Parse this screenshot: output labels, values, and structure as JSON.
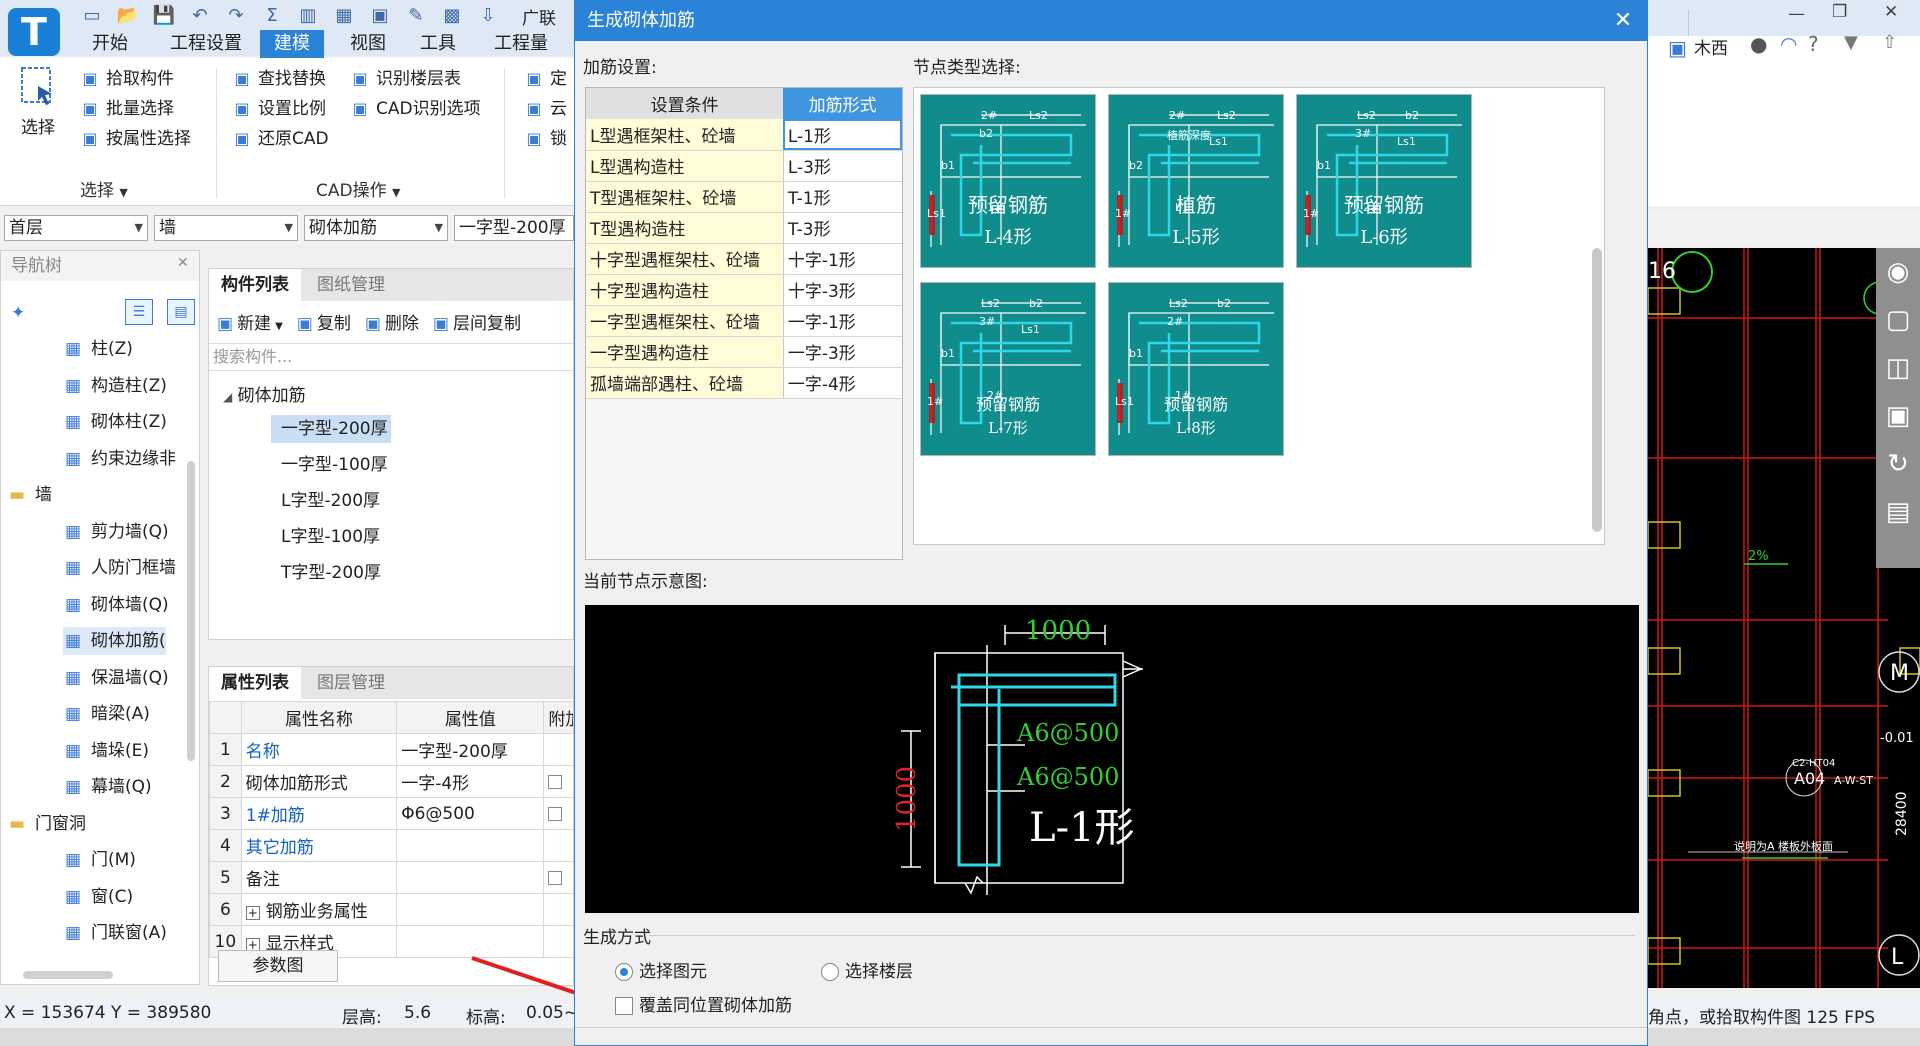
{
  "app": {
    "logo": "T",
    "title_partial": "广联"
  },
  "quick_access": [
    "new-icon",
    "open-icon",
    "save-icon",
    "undo-icon",
    "redo-icon",
    "sum-icon",
    "report-icon",
    "preview-icon",
    "export-icon",
    "pen-icon",
    "grid-icon",
    "import-icon"
  ],
  "menu_tabs": [
    {
      "label": "开始"
    },
    {
      "label": "工程设置"
    },
    {
      "label": "建模"
    },
    {
      "label": "视图"
    },
    {
      "label": "工具"
    },
    {
      "label": "工程量"
    }
  ],
  "ribbon": {
    "select_big": "选择",
    "col1": [
      "拾取构件",
      "批量选择",
      "按属性选择"
    ],
    "col1_group": "选择",
    "col2": [
      "查找替换",
      "设置比例",
      "还原CAD"
    ],
    "col3": [
      "识别楼层表",
      "CAD识别选项"
    ],
    "col2_group": "CAD操作",
    "col4": [
      "定",
      "云",
      "锁"
    ]
  },
  "selectors": [
    "首层",
    "墙",
    "砌体加筋",
    "一字型-200厚"
  ],
  "nav": {
    "title": "导航树",
    "items": [
      {
        "label": "柱(Z)",
        "indent": 1,
        "icon": "column-icon"
      },
      {
        "label": "构造柱(Z)",
        "indent": 1,
        "icon": "construct-column-icon"
      },
      {
        "label": "砌体柱(Z)",
        "indent": 1,
        "icon": "masonry-column-icon"
      },
      {
        "label": "约束边缘非",
        "indent": 1,
        "icon": "edge-icon"
      },
      {
        "label": "墙",
        "indent": 0,
        "icon": "folder-icon"
      },
      {
        "label": "剪力墙(Q)",
        "indent": 1,
        "icon": "shear-wall-icon"
      },
      {
        "label": "人防门框墙",
        "indent": 1,
        "icon": "door-frame-icon"
      },
      {
        "label": "砌体墙(Q)",
        "indent": 1,
        "icon": "brick-wall-icon"
      },
      {
        "label": "砌体加筋(",
        "indent": 1,
        "icon": "rebar-icon",
        "selected": true
      },
      {
        "label": "保温墙(Q)",
        "indent": 1,
        "icon": "insulation-icon"
      },
      {
        "label": "暗梁(A)",
        "indent": 1,
        "icon": "hidden-beam-icon"
      },
      {
        "label": "墙垛(E)",
        "indent": 1,
        "icon": "pier-icon"
      },
      {
        "label": "幕墙(Q)",
        "indent": 1,
        "icon": "curtain-wall-icon"
      },
      {
        "label": "门窗洞",
        "indent": 0,
        "icon": "folder-icon"
      },
      {
        "label": "门(M)",
        "indent": 1,
        "icon": "door-icon"
      },
      {
        "label": "窗(C)",
        "indent": 1,
        "icon": "window-icon"
      },
      {
        "label": "门联窗(A)",
        "indent": 1,
        "icon": "door-window-icon"
      }
    ]
  },
  "component_panel": {
    "tabs": [
      "构件列表",
      "图纸管理"
    ],
    "toolbar": [
      "新建",
      "复制",
      "删除",
      "层间复制"
    ],
    "search_placeholder": "搜索构件...",
    "root": "砌体加筋",
    "items": [
      "一字型-200厚",
      "一字型-100厚",
      "L字型-200厚",
      "L字型-100厚",
      "T字型-200厚"
    ],
    "selected_index": 0
  },
  "property_panel": {
    "tabs": [
      "属性列表",
      "图层管理"
    ],
    "headers": [
      "属性名称",
      "属性值",
      "附加"
    ],
    "rows": [
      {
        "n": "1",
        "name": "名称",
        "value": "一字型-200厚",
        "blue": true,
        "chk": false
      },
      {
        "n": "2",
        "name": "砌体加筋形式",
        "value": "一字-4形",
        "blue": false,
        "chk": true
      },
      {
        "n": "3",
        "name": "1#加筋",
        "value": "Φ6@500",
        "blue": true,
        "chk": true
      },
      {
        "n": "4",
        "name": "其它加筋",
        "value": "",
        "blue": true,
        "chk": false
      },
      {
        "n": "5",
        "name": "备注",
        "value": "",
        "blue": false,
        "chk": true
      },
      {
        "n": "6",
        "name": "钢筋业务属性",
        "value": "",
        "blue": false,
        "chk": false,
        "plus": true
      },
      {
        "n": "10",
        "name": "显示样式",
        "value": "",
        "blue": false,
        "chk": false,
        "plus": true
      }
    ],
    "param_button": "参数图"
  },
  "dialog": {
    "title": "生成砌体加筋",
    "settings_label": "加筋设置:",
    "node_label": "节点类型选择:",
    "table_headers": [
      "设置条件",
      "加筋形式"
    ],
    "table_rows": [
      [
        "L型遇框架柱、砼墙",
        "L-1形"
      ],
      [
        "L型遇构造柱",
        "L-3形"
      ],
      [
        "T型遇框架柱、砼墙",
        "T-1形"
      ],
      [
        "T型遇构造柱",
        "T-3形"
      ],
      [
        "十字型遇框架柱、砼墙",
        "十字-1形"
      ],
      [
        "十字型遇构造柱",
        "十字-3形"
      ],
      [
        "一字型遇框架柱、砼墙",
        "一字-1形"
      ],
      [
        "一字型遇构造柱",
        "一字-3形"
      ],
      [
        "孤墙端部遇柱、砼墙",
        "一字-4形"
      ]
    ],
    "nodes": [
      {
        "caption1": "预留钢筋",
        "caption2": "L-4形",
        "tags": [
          "2#",
          "Ls2",
          "b2",
          "b1",
          "1#",
          "Ls1"
        ]
      },
      {
        "caption1": "植筋",
        "caption2": "L-5形",
        "tags": [
          "2#",
          "Ls2",
          "植筋深度",
          "b2",
          "b1",
          "1#",
          "Ls1"
        ]
      },
      {
        "caption1": "预留钢筋",
        "caption2": "L-6形",
        "tags": [
          "Ls2",
          "b2",
          "3#",
          "b1",
          "2#",
          "1#",
          "Ls1"
        ]
      },
      {
        "caption1": "预留钢筋",
        "caption2": "L-7形",
        "tags": [
          "Ls2",
          "b2",
          "3#",
          "b1",
          "2#",
          "1#",
          "Ls1"
        ]
      },
      {
        "caption1": "预留钢筋",
        "caption2": "L-8形",
        "tags": [
          "Ls2",
          "b2",
          "2#",
          "b1",
          "1#",
          "Ls1"
        ]
      }
    ],
    "current_label": "当前节点示意图:",
    "preview": {
      "dim_h": "1000",
      "dim_v": "1000",
      "rebar1": "A6@500",
      "rebar2": "A6@500",
      "shape": "L-1形"
    },
    "gen_label": "生成方式",
    "radio1": "选择图元",
    "radio2": "选择楼层",
    "checkbox": "覆盖同位置砌体加筋"
  },
  "cad": {
    "user": "木西",
    "labels": {
      "c16": "16",
      "m": "M",
      "l": "L",
      "pct": "2%",
      "neg": "-0.01",
      "depth": "28400",
      "tag": "C2-HT04",
      "tag2": "A04",
      "tag3": "A-W-ST",
      "note": "说明为A 楼板外板面"
    }
  },
  "status": {
    "coords": "X = 153674 Y = 389580",
    "floor_h_label": "层高:",
    "floor_h": "5.6",
    "elev_label": "标高:",
    "elev": "0.05~",
    "right_text": "角点，或拾取构件图 125 FPS"
  },
  "colors": {
    "accent": "#2a83d6",
    "node_bg": "#118c8c",
    "cad_red": "#e0202a",
    "cad_cyan": "#2fd8e8",
    "cad_green": "#30d030"
  }
}
